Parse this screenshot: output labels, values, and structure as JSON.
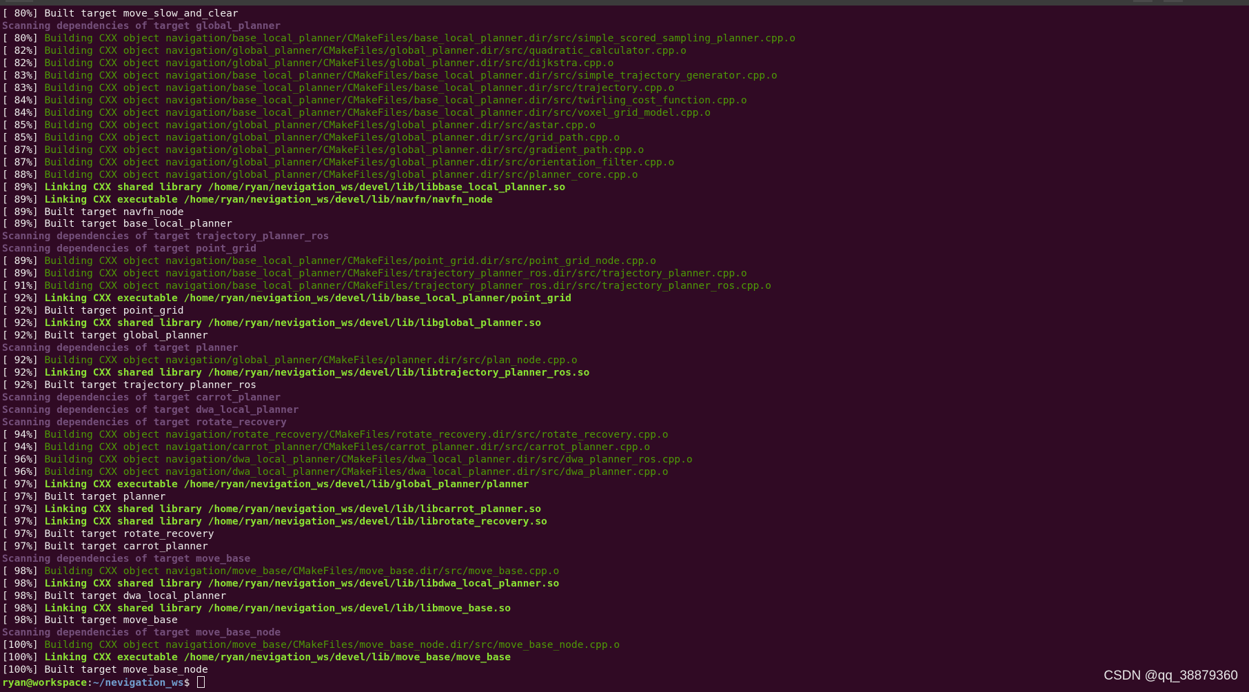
{
  "terminal": {
    "lines": [
      {
        "pct": "[ 80%]",
        "kind": "built",
        "text": "Built target move_slow_and_clear"
      },
      {
        "kind": "scan",
        "text": "Scanning dependencies of target global_planner"
      },
      {
        "pct": "[ 80%]",
        "kind": "compile",
        "text": "Building CXX object navigation/base_local_planner/CMakeFiles/base_local_planner.dir/src/simple_scored_sampling_planner.cpp.o"
      },
      {
        "pct": "[ 82%]",
        "kind": "compile",
        "text": "Building CXX object navigation/global_planner/CMakeFiles/global_planner.dir/src/quadratic_calculator.cpp.o"
      },
      {
        "pct": "[ 82%]",
        "kind": "compile",
        "text": "Building CXX object navigation/global_planner/CMakeFiles/global_planner.dir/src/dijkstra.cpp.o"
      },
      {
        "pct": "[ 83%]",
        "kind": "compile",
        "text": "Building CXX object navigation/base_local_planner/CMakeFiles/base_local_planner.dir/src/simple_trajectory_generator.cpp.o"
      },
      {
        "pct": "[ 83%]",
        "kind": "compile",
        "text": "Building CXX object navigation/base_local_planner/CMakeFiles/base_local_planner.dir/src/trajectory.cpp.o"
      },
      {
        "pct": "[ 84%]",
        "kind": "compile",
        "text": "Building CXX object navigation/base_local_planner/CMakeFiles/base_local_planner.dir/src/twirling_cost_function.cpp.o"
      },
      {
        "pct": "[ 84%]",
        "kind": "compile",
        "text": "Building CXX object navigation/base_local_planner/CMakeFiles/base_local_planner.dir/src/voxel_grid_model.cpp.o"
      },
      {
        "pct": "[ 85%]",
        "kind": "compile",
        "text": "Building CXX object navigation/global_planner/CMakeFiles/global_planner.dir/src/astar.cpp.o"
      },
      {
        "pct": "[ 85%]",
        "kind": "compile",
        "text": "Building CXX object navigation/global_planner/CMakeFiles/global_planner.dir/src/grid_path.cpp.o"
      },
      {
        "pct": "[ 87%]",
        "kind": "compile",
        "text": "Building CXX object navigation/global_planner/CMakeFiles/global_planner.dir/src/gradient_path.cpp.o"
      },
      {
        "pct": "[ 87%]",
        "kind": "compile",
        "text": "Building CXX object navigation/global_planner/CMakeFiles/global_planner.dir/src/orientation_filter.cpp.o"
      },
      {
        "pct": "[ 88%]",
        "kind": "compile",
        "text": "Building CXX object navigation/global_planner/CMakeFiles/global_planner.dir/src/planner_core.cpp.o"
      },
      {
        "pct": "[ 89%]",
        "kind": "link",
        "text": "Linking CXX shared library /home/ryan/nevigation_ws/devel/lib/libbase_local_planner.so"
      },
      {
        "pct": "[ 89%]",
        "kind": "link",
        "text": "Linking CXX executable /home/ryan/nevigation_ws/devel/lib/navfn/navfn_node"
      },
      {
        "pct": "[ 89%]",
        "kind": "built",
        "text": "Built target navfn_node"
      },
      {
        "pct": "[ 89%]",
        "kind": "built",
        "text": "Built target base_local_planner"
      },
      {
        "kind": "scan",
        "text": "Scanning dependencies of target trajectory_planner_ros"
      },
      {
        "kind": "scan",
        "text": "Scanning dependencies of target point_grid"
      },
      {
        "pct": "[ 89%]",
        "kind": "compile",
        "text": "Building CXX object navigation/base_local_planner/CMakeFiles/point_grid.dir/src/point_grid_node.cpp.o"
      },
      {
        "pct": "[ 89%]",
        "kind": "compile",
        "text": "Building CXX object navigation/base_local_planner/CMakeFiles/trajectory_planner_ros.dir/src/trajectory_planner.cpp.o"
      },
      {
        "pct": "[ 91%]",
        "kind": "compile",
        "text": "Building CXX object navigation/base_local_planner/CMakeFiles/trajectory_planner_ros.dir/src/trajectory_planner_ros.cpp.o"
      },
      {
        "pct": "[ 92%]",
        "kind": "link",
        "text": "Linking CXX executable /home/ryan/nevigation_ws/devel/lib/base_local_planner/point_grid"
      },
      {
        "pct": "[ 92%]",
        "kind": "built",
        "text": "Built target point_grid"
      },
      {
        "pct": "[ 92%]",
        "kind": "link",
        "text": "Linking CXX shared library /home/ryan/nevigation_ws/devel/lib/libglobal_planner.so"
      },
      {
        "pct": "[ 92%]",
        "kind": "built",
        "text": "Built target global_planner"
      },
      {
        "kind": "scan",
        "text": "Scanning dependencies of target planner"
      },
      {
        "pct": "[ 92%]",
        "kind": "compile",
        "text": "Building CXX object navigation/global_planner/CMakeFiles/planner.dir/src/plan_node.cpp.o"
      },
      {
        "pct": "[ 92%]",
        "kind": "link",
        "text": "Linking CXX shared library /home/ryan/nevigation_ws/devel/lib/libtrajectory_planner_ros.so"
      },
      {
        "pct": "[ 92%]",
        "kind": "built",
        "text": "Built target trajectory_planner_ros"
      },
      {
        "kind": "scan",
        "text": "Scanning dependencies of target carrot_planner"
      },
      {
        "kind": "scan",
        "text": "Scanning dependencies of target dwa_local_planner"
      },
      {
        "kind": "scan",
        "text": "Scanning dependencies of target rotate_recovery"
      },
      {
        "pct": "[ 94%]",
        "kind": "compile",
        "text": "Building CXX object navigation/rotate_recovery/CMakeFiles/rotate_recovery.dir/src/rotate_recovery.cpp.o"
      },
      {
        "pct": "[ 94%]",
        "kind": "compile",
        "text": "Building CXX object navigation/carrot_planner/CMakeFiles/carrot_planner.dir/src/carrot_planner.cpp.o"
      },
      {
        "pct": "[ 96%]",
        "kind": "compile",
        "text": "Building CXX object navigation/dwa_local_planner/CMakeFiles/dwa_local_planner.dir/src/dwa_planner_ros.cpp.o"
      },
      {
        "pct": "[ 96%]",
        "kind": "compile",
        "text": "Building CXX object navigation/dwa_local_planner/CMakeFiles/dwa_local_planner.dir/src/dwa_planner.cpp.o"
      },
      {
        "pct": "[ 97%]",
        "kind": "link",
        "text": "Linking CXX executable /home/ryan/nevigation_ws/devel/lib/global_planner/planner"
      },
      {
        "pct": "[ 97%]",
        "kind": "built",
        "text": "Built target planner"
      },
      {
        "pct": "[ 97%]",
        "kind": "link",
        "text": "Linking CXX shared library /home/ryan/nevigation_ws/devel/lib/libcarrot_planner.so"
      },
      {
        "pct": "[ 97%]",
        "kind": "link",
        "text": "Linking CXX shared library /home/ryan/nevigation_ws/devel/lib/librotate_recovery.so"
      },
      {
        "pct": "[ 97%]",
        "kind": "built",
        "text": "Built target rotate_recovery"
      },
      {
        "pct": "[ 97%]",
        "kind": "built",
        "text": "Built target carrot_planner"
      },
      {
        "kind": "scan",
        "text": "Scanning dependencies of target move_base"
      },
      {
        "pct": "[ 98%]",
        "kind": "compile",
        "text": "Building CXX object navigation/move_base/CMakeFiles/move_base.dir/src/move_base.cpp.o"
      },
      {
        "pct": "[ 98%]",
        "kind": "link",
        "text": "Linking CXX shared library /home/ryan/nevigation_ws/devel/lib/libdwa_local_planner.so"
      },
      {
        "pct": "[ 98%]",
        "kind": "built",
        "text": "Built target dwa_local_planner"
      },
      {
        "pct": "[ 98%]",
        "kind": "link",
        "text": "Linking CXX shared library /home/ryan/nevigation_ws/devel/lib/libmove_base.so"
      },
      {
        "pct": "[ 98%]",
        "kind": "built",
        "text": "Built target move_base"
      },
      {
        "kind": "scan",
        "text": "Scanning dependencies of target move_base_node"
      },
      {
        "pct": "[100%]",
        "kind": "compile",
        "text": "Building CXX object navigation/move_base/CMakeFiles/move_base_node.dir/src/move_base_node.cpp.o"
      },
      {
        "pct": "[100%]",
        "kind": "link",
        "text": "Linking CXX executable /home/ryan/nevigation_ws/devel/lib/move_base/move_base"
      },
      {
        "pct": "[100%]",
        "kind": "built",
        "text": "Built target move_base_node"
      }
    ],
    "prompt": {
      "user_host": "ryan@workspace",
      "separator": ":",
      "path": "~/nevigation_ws",
      "symbol": "$ "
    }
  },
  "watermark": "CSDN @qq_38879360",
  "colors": {
    "background": "#300a24",
    "text": "#eeeeec",
    "compile": "#4e9a06",
    "link": "#8ae234",
    "scan": "#75507b",
    "prompt_path": "#729fcf"
  }
}
